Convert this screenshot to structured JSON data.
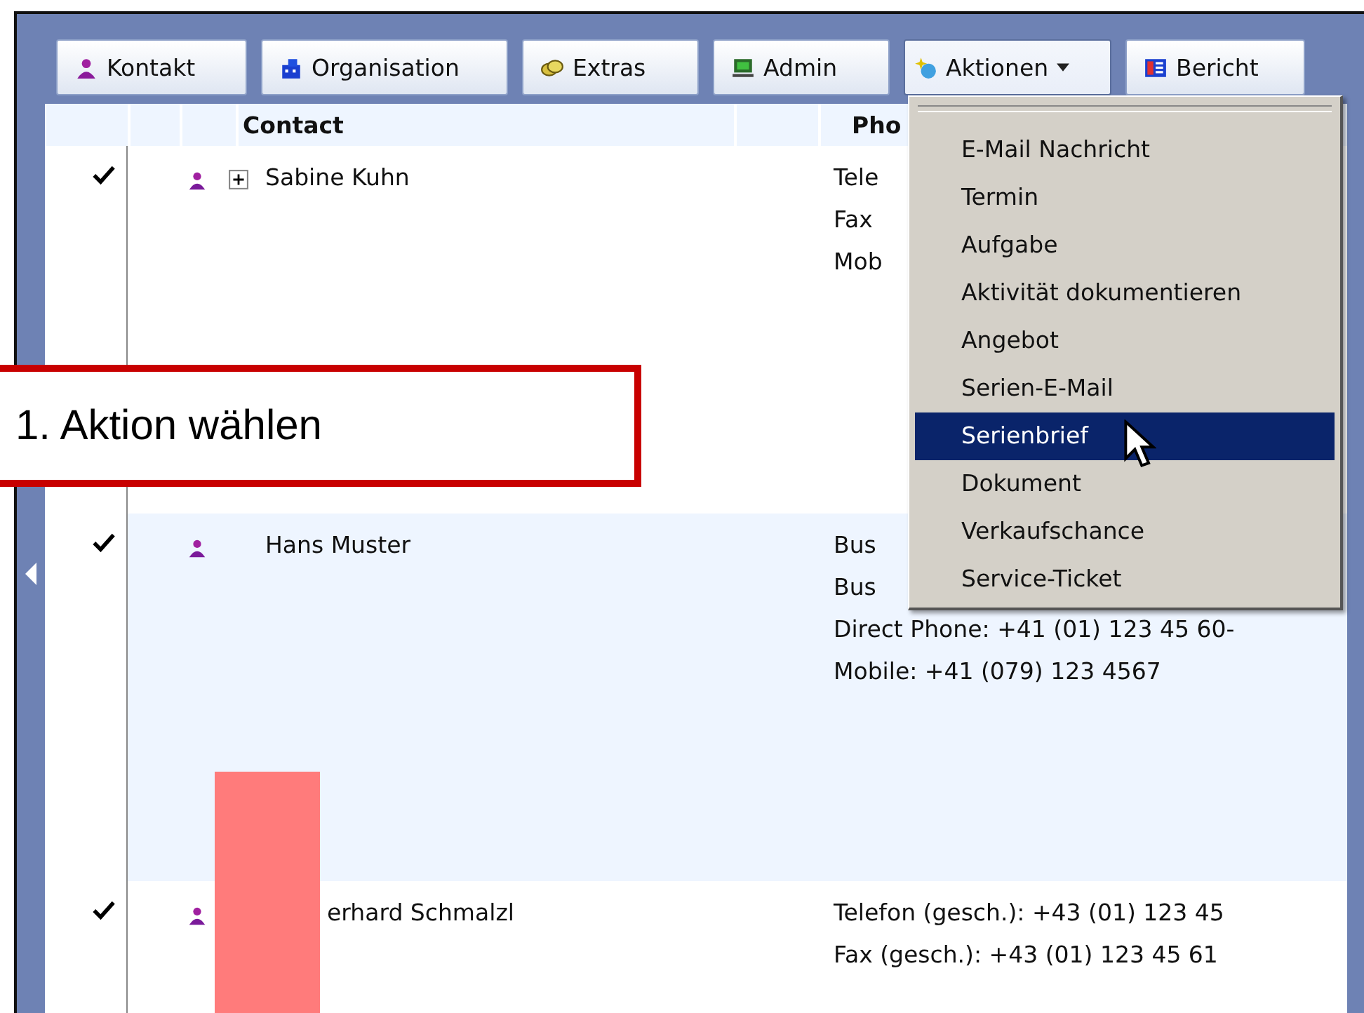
{
  "toolbar": {
    "buttons": [
      {
        "label": "Kontakt",
        "kind": "person",
        "dropdown": false,
        "open": false
      },
      {
        "label": "Organisation",
        "kind": "building",
        "dropdown": false,
        "open": false
      },
      {
        "label": "Extras",
        "kind": "coins",
        "dropdown": false,
        "open": false
      },
      {
        "label": "Admin",
        "kind": "computer",
        "dropdown": false,
        "open": false
      },
      {
        "label": "Aktionen",
        "kind": "sparkle",
        "dropdown": true,
        "open": true
      },
      {
        "label": "Bericht",
        "kind": "report",
        "dropdown": false,
        "open": false
      }
    ]
  },
  "table": {
    "columns": [
      "Contact",
      "Pho"
    ],
    "rows": [
      {
        "checked": true,
        "selected": false,
        "expandable": true,
        "covered": false,
        "name": "Sabine Kuhn",
        "phones": [
          "Tele",
          "Fax",
          "Mob"
        ]
      },
      {
        "checked": true,
        "selected": true,
        "expandable": false,
        "covered": false,
        "name": "Hans Muster",
        "phones": [
          "Bus",
          "Bus",
          "Direct Phone: +41 (01) 123 45 60-",
          "Mobile: +41 (079) 123 4567"
        ]
      },
      {
        "checked": true,
        "selected": false,
        "expandable": false,
        "covered": true,
        "name": "erhard Schmalzl",
        "phones": [
          "Telefon (gesch.): +43 (01) 123 45",
          "Fax (gesch.): +43 (01) 123 45 61"
        ]
      }
    ]
  },
  "menu": {
    "items": [
      {
        "label": "E-Mail Nachricht",
        "selected": false
      },
      {
        "label": "Termin",
        "selected": false
      },
      {
        "label": "Aufgabe",
        "selected": false
      },
      {
        "label": "Aktivität dokumentieren",
        "selected": false
      },
      {
        "label": "Angebot",
        "selected": false
      },
      {
        "label": "Serien-E-Mail",
        "selected": false
      },
      {
        "label": "Serienbrief",
        "selected": true
      },
      {
        "label": "Dokument",
        "selected": false
      },
      {
        "label": "Verkaufschance",
        "selected": false
      },
      {
        "label": "Service-Ticket",
        "selected": false
      }
    ]
  },
  "callout": {
    "text": "1. Aktion wählen"
  }
}
